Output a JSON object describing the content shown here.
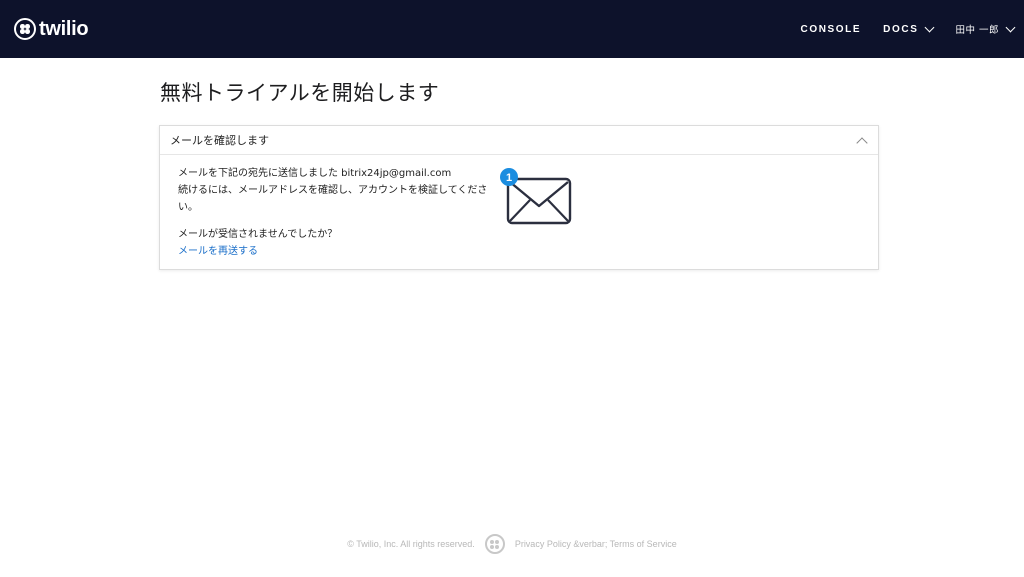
{
  "header": {
    "logo_text": "twilio",
    "nav": {
      "console": "CONSOLE",
      "docs": "DOCS",
      "user": "田中 一郎"
    }
  },
  "page": {
    "title": "無料トライアルを開始します"
  },
  "card": {
    "title": "メールを確認します",
    "message_line1": "メールを下記の宛先に送信しました bitrix24jp@gmail.com",
    "message_line2": "続けるには、メールアドレスを確認し、アカウントを検証してください。",
    "not_received": "メールが受信されませんでしたか？",
    "resend_link": "メールを再送する",
    "notification_count": "1"
  },
  "footer": {
    "copyright": "© Twilio, Inc. All rights reserved.",
    "links": "Privacy Policy &verbar; Terms of Service"
  },
  "colors": {
    "header_bg": "#0d122b",
    "link": "#1b6fc9",
    "badge": "#1b8de0",
    "envelope_stroke": "#2b2f3f"
  },
  "icons": {
    "logo": "twilio-logo-icon",
    "docs_dropdown": "chevron-down-icon",
    "user_dropdown": "chevron-down-icon",
    "collapse": "chevron-up-icon",
    "mail": "envelope-icon"
  }
}
